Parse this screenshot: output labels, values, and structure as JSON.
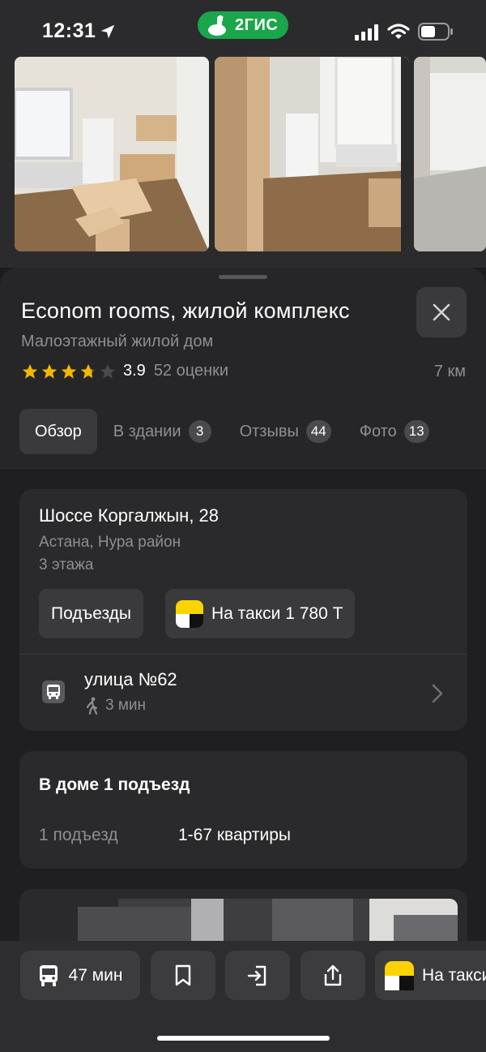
{
  "status_bar": {
    "time": "12:31",
    "app_badge": "2ГИС"
  },
  "place": {
    "title": "Econom rooms, жилой комплекс",
    "subtitle": "Малоэтажный жилой дом",
    "rating": "3.9",
    "rating_stars": 3.9,
    "rating_count": "52 оценки",
    "distance": "7 км"
  },
  "tabs": [
    {
      "label": "Обзор",
      "count": null,
      "active": true
    },
    {
      "label": "В здании",
      "count": "3"
    },
    {
      "label": "Отзывы",
      "count": "44"
    },
    {
      "label": "Фото",
      "count": "13"
    }
  ],
  "address_card": {
    "address": "Шоссе Коргалжын, 28",
    "city": "Астана, Нура район",
    "floors": "3 этажа",
    "entrances_button": "Подъезды",
    "taxi_button": "На такси 1 780 Т",
    "transit": {
      "name": "улица №62",
      "walk_time": "3 мин"
    }
  },
  "entrance_card": {
    "title": "В доме 1 подъезд",
    "label": "1 подъезд",
    "value": "1-67 квартиры"
  },
  "toolbar": {
    "route_time": "47 мин",
    "taxi_label": "На такси"
  },
  "colors": {
    "brand_green": "#1aa64a",
    "taxi_yellow": "#fcd300",
    "star": "#f5b700",
    "background": "#1f1f21"
  }
}
